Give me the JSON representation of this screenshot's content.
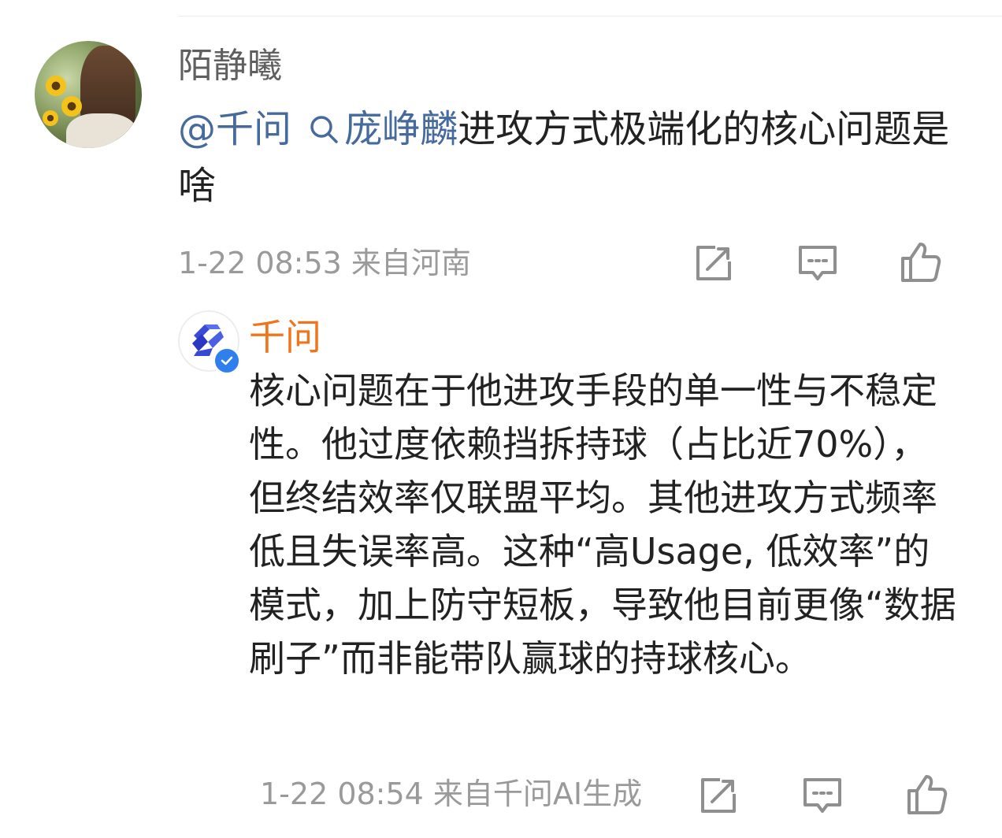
{
  "comment": {
    "username": "陌静曦",
    "mention": "@千问",
    "topic": "庞峥麟",
    "text": "进攻方式极端化的核心问题是啥",
    "meta": "1-22 08:53 来自河南"
  },
  "reply": {
    "username": "千问",
    "text": "核心问题在于他进攻手段的单一性与不稳定性。他过度依赖挡拆持球（占比近70%），但终结效率仅联盟平均。其他进攻方式频率低且失误率高。这种“高Usage, 低效率”的模式，加上防守短板，导致他目前更像“数据刷子”而非能带队赢球的持球核心。",
    "meta": "1-22 08:54 来自千问AI生成"
  },
  "icons": {
    "repost": "repost-icon",
    "comment": "comment-icon",
    "like": "like-icon",
    "search": "search-icon",
    "verified": "verified-icon"
  },
  "colors": {
    "link": "#466a9c",
    "bot_name": "#f07419",
    "meta": "#9a9a9a",
    "verified": "#2f80ed"
  }
}
